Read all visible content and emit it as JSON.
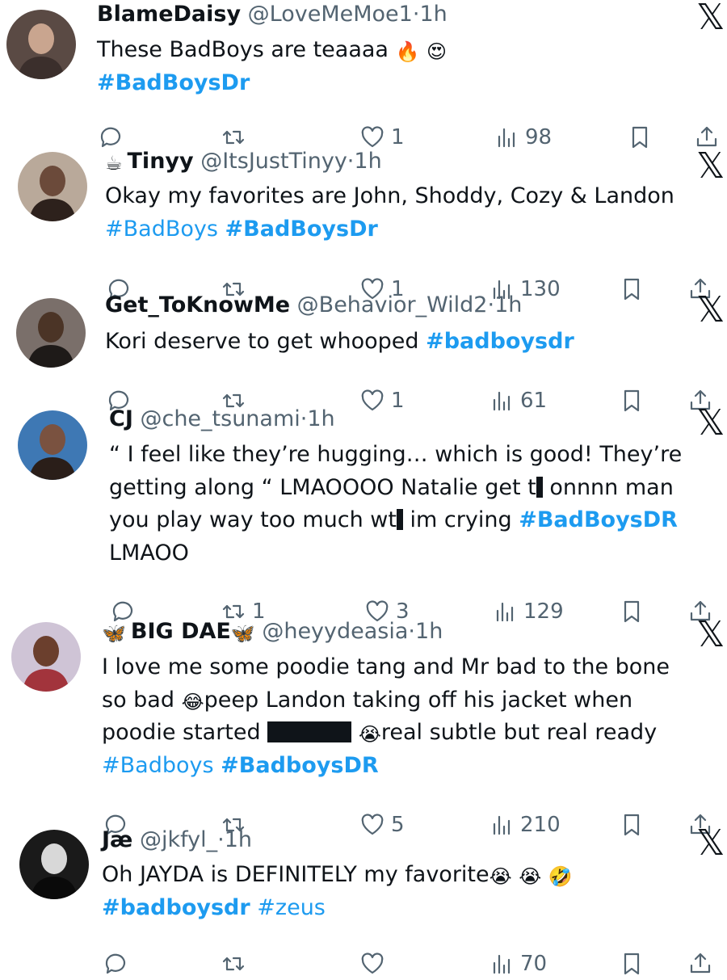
{
  "tweets": [
    {
      "name": "BlameDaisy",
      "name_prefix": "",
      "name_suffix": "",
      "handle": "@LoveMeMoe1",
      "sep": "·",
      "time": "1h",
      "lines": [
        [
          {
            "t": "These BadBoys are teaaaa "
          },
          {
            "e": "🔥"
          },
          {
            "t": " "
          },
          {
            "e": "😍"
          }
        ],
        [
          {
            "tag": "#BadBoysDr"
          }
        ]
      ],
      "replies": "",
      "retweets": "",
      "likes": "1",
      "views": "98"
    },
    {
      "name": "Tinyy",
      "name_prefix": "☕",
      "name_suffix": "",
      "handle": "@ItsJustTinyy",
      "sep": "·",
      "time": "1h",
      "lines": [
        [
          {
            "t": "Okay my favorites are John, Shoddy, Cozy & Landon"
          }
        ],
        [
          {
            "tagl": "#BadBoys"
          },
          {
            "t": " "
          },
          {
            "tag": "#BadBoysDr"
          }
        ]
      ],
      "replies": "",
      "retweets": "",
      "likes": "1",
      "views": "130"
    },
    {
      "name": "Get_ToKnowMe",
      "name_prefix": "",
      "name_suffix": "",
      "handle": "@Behavior_Wild2",
      "sep": "·",
      "time": "1h",
      "lines": [
        [
          {
            "t": "Kori deserve to get whooped  "
          },
          {
            "tag": "#badboysdr"
          }
        ]
      ],
      "replies": "",
      "retweets": "",
      "likes": "1",
      "views": "61"
    },
    {
      "name": "CJ",
      "name_prefix": "",
      "name_suffix": "",
      "handle": "@che_tsunami",
      "sep": "·",
      "time": "1h",
      "lines": [
        [
          {
            "t": "“ I feel like they’re hugging… which is good! They’re"
          }
        ],
        [
          {
            "t": "getting along “ LMAOOOO Natalie get t"
          },
          {
            "r": "8"
          },
          {
            "t": " onnnn man"
          }
        ],
        [
          {
            "t": "you play way too much wt"
          },
          {
            "r": "8"
          },
          {
            "t": " im crying "
          },
          {
            "tag": "#BadBoysDR"
          }
        ],
        [
          {
            "t": "LMAOO"
          }
        ]
      ],
      "replies": "",
      "retweets": "1",
      "likes": "3",
      "views": "129"
    },
    {
      "name": "BIG DAE",
      "name_prefix": "🦋",
      "name_suffix": "🦋",
      "handle": "@heyydeasia",
      "sep": "·",
      "time": "1h",
      "lines": [
        [
          {
            "t": "I love me some poodie tang and Mr bad to the bone"
          }
        ],
        [
          {
            "t": "so bad "
          },
          {
            "e": "😂"
          },
          {
            "t": "peep Landon taking off his jacket when"
          }
        ],
        [
          {
            "t": "poodie started "
          },
          {
            "r": "104"
          },
          {
            "t": " "
          },
          {
            "e": "😭"
          },
          {
            "t": "real subtle but real ready"
          }
        ],
        [
          {
            "tagl": "#Badboys"
          },
          {
            "t": " "
          },
          {
            "tag": "#BadboysDR"
          }
        ]
      ],
      "replies": "",
      "retweets": "",
      "likes": "5",
      "views": "210"
    },
    {
      "name": "Jæ",
      "name_prefix": "",
      "name_suffix": "",
      "handle": "@jkfyl_",
      "sep": "·",
      "time": "1h",
      "lines": [
        [
          {
            "t": "Oh JAYDA is DEFINITELY my favorite"
          },
          {
            "e": "😭"
          },
          {
            "t": " "
          },
          {
            "e": "😭"
          },
          {
            "t": " "
          },
          {
            "e": "🤣"
          }
        ],
        [
          {
            "tag": "#badboysdr"
          },
          {
            "t": " "
          },
          {
            "tagl": "#zeus"
          }
        ]
      ],
      "replies": "",
      "retweets": "",
      "likes": "",
      "views": "70"
    }
  ],
  "icons": {
    "x_logo": "𝕏",
    "reply": "reply-icon",
    "retweet": "retweet-icon",
    "like": "heart-icon",
    "views": "views-icon",
    "bookmark": "bookmark-icon",
    "share": "share-icon"
  },
  "colors": {
    "link": "#1d9bf0",
    "muted": "#536471",
    "text": "#0f1419"
  }
}
